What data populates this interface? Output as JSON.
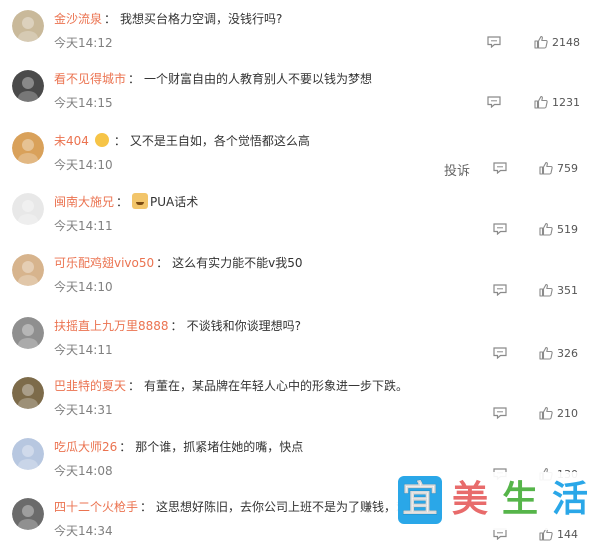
{
  "comments": [
    {
      "user": "金沙流泉",
      "text": "我想买台格力空调，没钱行吗?",
      "time": "今天14:12",
      "likes": "2148"
    },
    {
      "user": "看不见得城市",
      "text": "一个财富自由的人教育别人不要以钱为梦想",
      "time": "今天14:15",
      "likes": "1231"
    },
    {
      "user": "未404",
      "text": "又不是王自如，各个觉悟都这么高",
      "time": "今天14:10",
      "likes": "759",
      "report": "投诉"
    },
    {
      "user": "闽南大施兄",
      "text": "PUA话术",
      "time": "今天14:11",
      "likes": "519"
    },
    {
      "user": "可乐配鸡翅vivo50",
      "text": "这么有实力能不能v我50",
      "time": "今天14:10",
      "likes": "351"
    },
    {
      "user": "扶摇直上九万里8888",
      "text": "不谈钱和你谈理想吗?",
      "time": "今天14:11",
      "likes": "326"
    },
    {
      "user": "巴韭特的夏天",
      "text": "有董在，某品牌在年轻人心中的形象进一步下跌。",
      "time": "今天14:31",
      "likes": "210"
    },
    {
      "user": "吃瓜大师26",
      "text": "那个谁，抓紧堵住她的嘴，快点",
      "time": "今天14:08",
      "likes": "130"
    },
    {
      "user": "四十二个火枪手",
      "text": "这思想好陈旧，去你公司上班不是为了赚钱，难",
      "time": "今天14:34",
      "likes": "144"
    }
  ],
  "watermark": [
    "宜",
    "美",
    "生",
    "活"
  ],
  "avatar_colors": [
    "#c9b99a",
    "#4a4a4a",
    "#d9a15a",
    "#e8e8e8",
    "#d7b48d",
    "#8f8f8f",
    "#7d6b4a",
    "#b7c7e0",
    "#6b6b6b"
  ]
}
